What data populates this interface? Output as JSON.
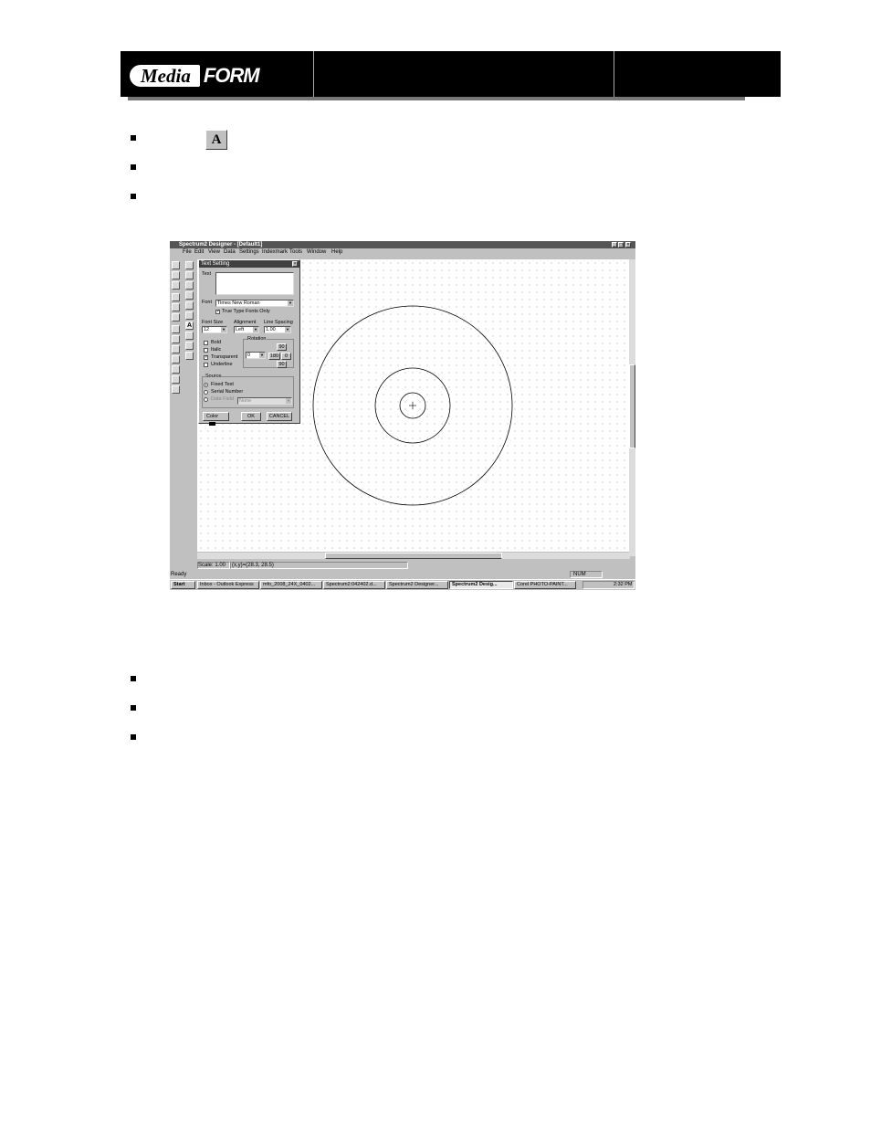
{
  "header": {
    "logo_media": "Media",
    "logo_form": "FORM"
  },
  "app": {
    "title": "Spectrum2 Designer - [Default1]",
    "window_buttons": [
      "_",
      "□",
      "×"
    ],
    "menu": [
      "File",
      "Edit",
      "View",
      "Data",
      "Settings",
      "Indexmark",
      "Tools",
      "Window",
      "Help"
    ],
    "status": {
      "scale": "Scale: 1.00",
      "coords": "(x,y)=(28.3, 28.5)",
      "ready": "Ready",
      "num": "NUM"
    },
    "taskbar": {
      "start": "Start",
      "tasks": [
        "Inbox - Outlook Express",
        "mfo_2008_24X_0402...",
        "Spectrum2:042402.d...",
        "Spectrum2 Designer...",
        "Spectrum2 Desig...",
        "Corel PHOTO-PAINT..."
      ],
      "clock": "2:32 PM"
    }
  },
  "dialog": {
    "title": "Text Setting",
    "text_label": "Text",
    "font_label": "Font",
    "font_value": "Times New Roman",
    "truetype_label": "True Type Fonts Only",
    "fontsize_label": "Font Size",
    "fontsize_value": "12",
    "alignment_label": "Alignment",
    "alignment_value": "Left",
    "linespacing_label": "Line Spacing",
    "linespacing_value": "1.00",
    "rotation_label": "Rotation",
    "rotation_value": "0",
    "rot_90_top": "90",
    "rot_180": "180",
    "rot_0": "0",
    "rot_90_bottom": "90",
    "bold_label": "Bold",
    "italic_label": "Italic",
    "transparent_label": "Transparent",
    "underline_label": "Underline",
    "source_label": "Source",
    "fixed_text_label": "Fixed Text",
    "serial_label": "Serial Number",
    "datafield_label": "Data Field",
    "datafield_value": "None",
    "color_label": "Color",
    "ok_label": "OK",
    "cancel_label": "CANCEL"
  }
}
